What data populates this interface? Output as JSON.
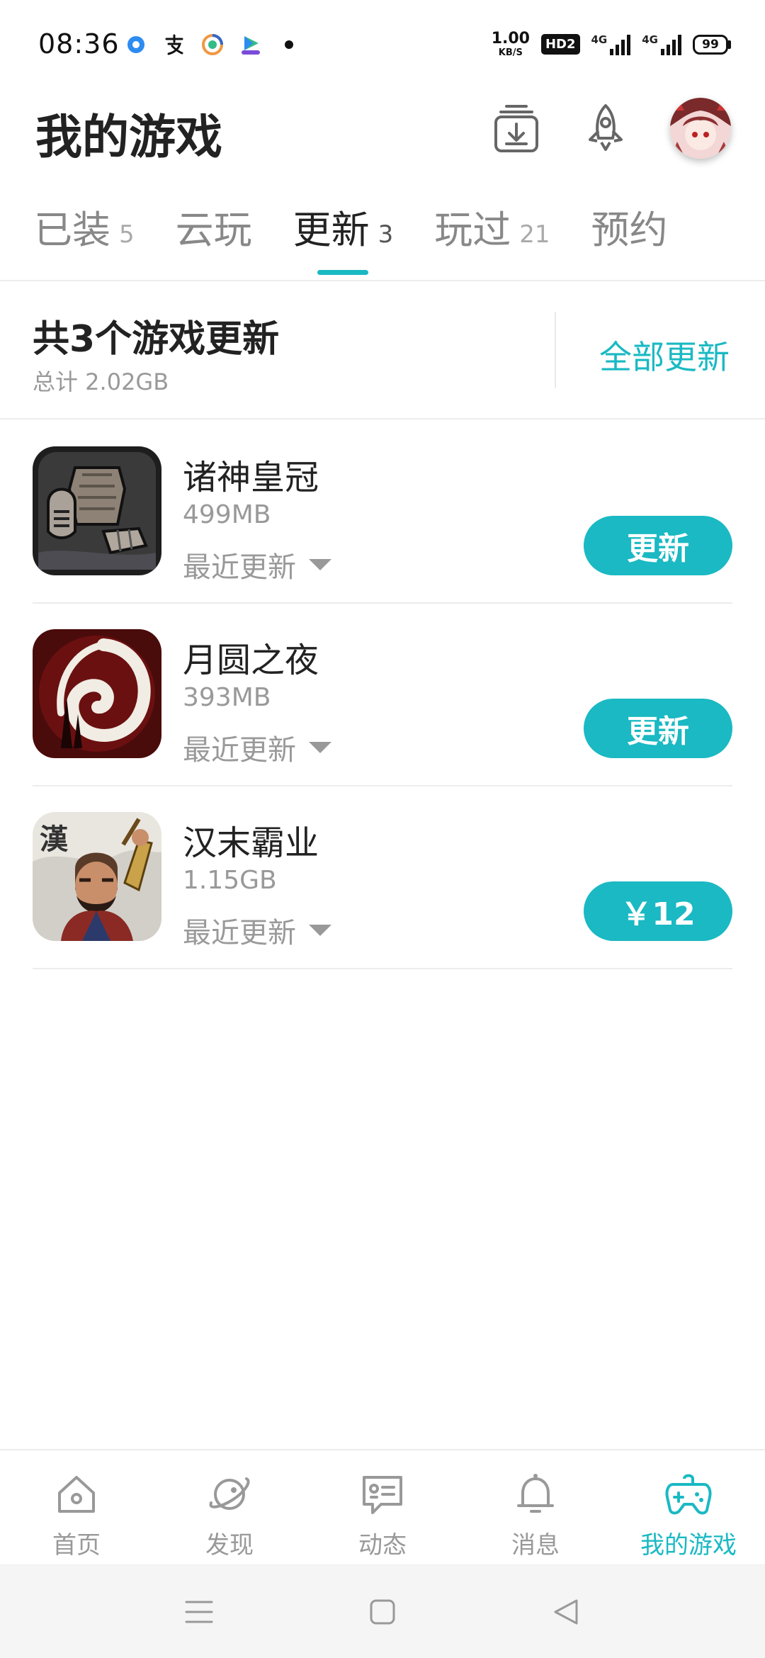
{
  "status_bar": {
    "time": "08:36",
    "net_speed_value": "1.00",
    "net_speed_unit": "KB/S",
    "hd_badge": "HD2",
    "signal_1": "4G",
    "signal_2": "4G",
    "battery": "99"
  },
  "header": {
    "title": "我的游戏",
    "download_icon": "download-manager-icon",
    "rocket_icon": "rocket-icon"
  },
  "tabs": [
    {
      "label": "已装",
      "count": "5"
    },
    {
      "label": "云玩",
      "count": ""
    },
    {
      "label": "更新",
      "count": "3",
      "active": true
    },
    {
      "label": "玩过",
      "count": "21"
    },
    {
      "label": "预约",
      "count": ""
    }
  ],
  "summary": {
    "title": "共3个游戏更新",
    "subtitle": "总计  2.02GB",
    "update_all": "全部更新"
  },
  "games": [
    {
      "name": "诸神皇冠",
      "size": "499MB",
      "recent": "最近更新",
      "action": "更新"
    },
    {
      "name": "月圆之夜",
      "size": "393MB",
      "recent": "最近更新",
      "action": "更新"
    },
    {
      "name": "汉末霸业",
      "size": "1.15GB",
      "recent": "最近更新",
      "action": "￥12",
      "icon_text": "漢"
    }
  ],
  "bottom_nav": [
    {
      "label": "首页",
      "icon": "home-icon"
    },
    {
      "label": "发现",
      "icon": "discover-planet-icon"
    },
    {
      "label": "动态",
      "icon": "feed-message-icon"
    },
    {
      "label": "消息",
      "icon": "bell-icon"
    },
    {
      "label": "我的游戏",
      "icon": "gamepad-icon",
      "active": true
    }
  ],
  "colors": {
    "accent": "#1ab9c3",
    "text_primary": "#222222",
    "text_secondary": "#999999"
  }
}
